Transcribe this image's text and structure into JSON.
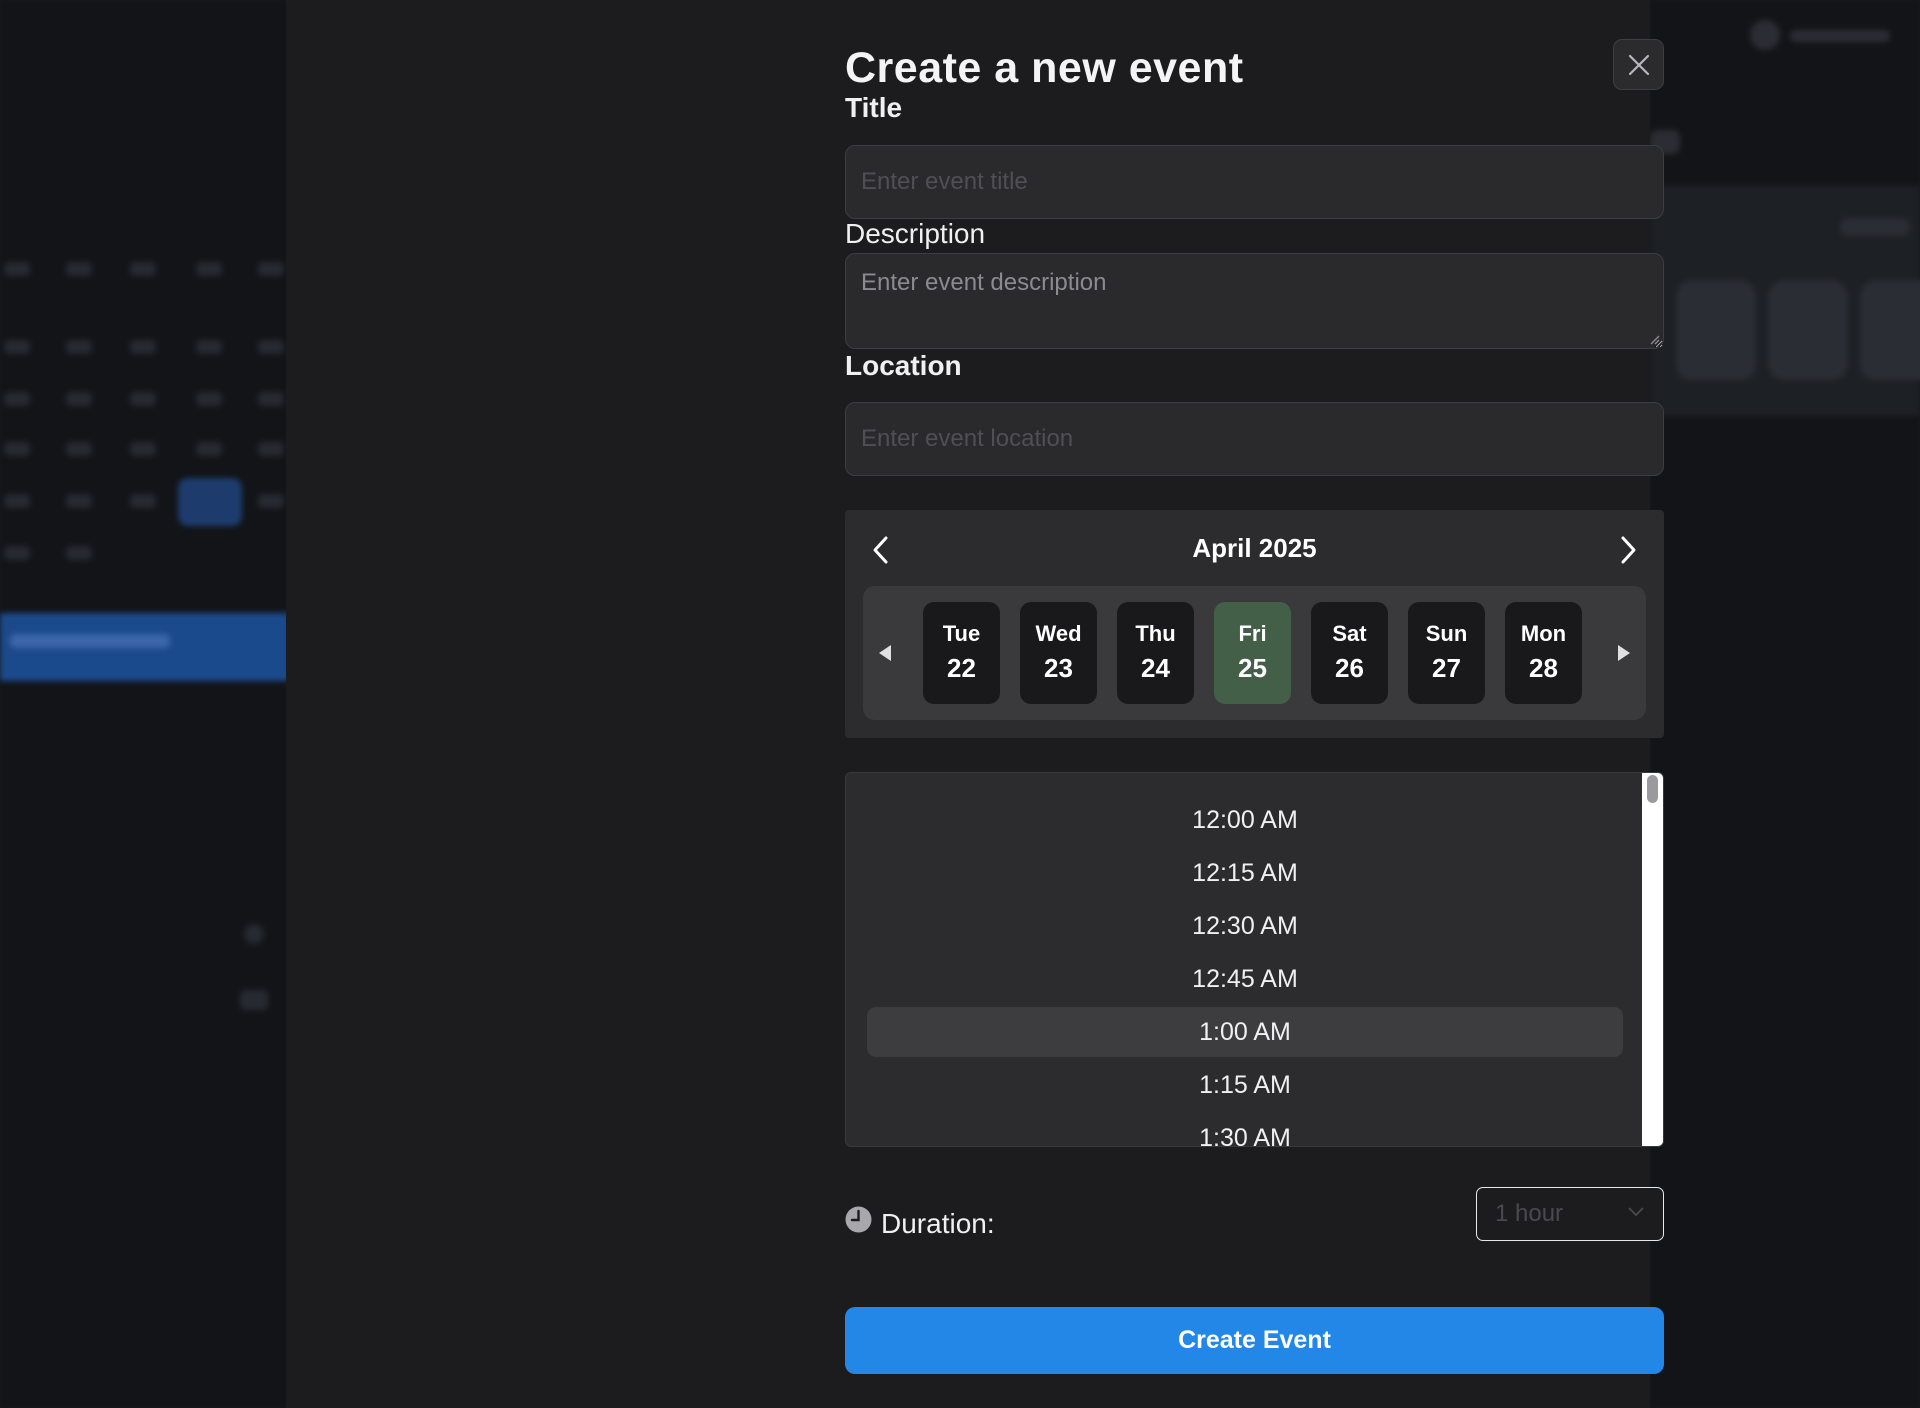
{
  "dialog": {
    "title": "Create a new event"
  },
  "form": {
    "title_label": "Title",
    "title_placeholder": "Enter event title",
    "description_label": "Description",
    "description_placeholder": "Enter event description",
    "location_label": "Location",
    "location_placeholder": "Enter event location"
  },
  "date_picker": {
    "month": "April 2025",
    "days": [
      {
        "name": "Tue",
        "num": "22",
        "selected": false
      },
      {
        "name": "Wed",
        "num": "23",
        "selected": false
      },
      {
        "name": "Thu",
        "num": "24",
        "selected": false
      },
      {
        "name": "Fri",
        "num": "25",
        "selected": true
      },
      {
        "name": "Sat",
        "num": "26",
        "selected": false
      },
      {
        "name": "Sun",
        "num": "27",
        "selected": false
      },
      {
        "name": "Mon",
        "num": "28",
        "selected": false
      }
    ],
    "selected_color": "#445f48"
  },
  "time_list": {
    "items": [
      "12:00 AM",
      "12:15 AM",
      "12:30 AM",
      "12:45 AM",
      "1:00 AM",
      "1:15 AM",
      "1:30 AM"
    ],
    "selected": "1:00 AM"
  },
  "duration": {
    "label": "Duration:",
    "value": "1 hour",
    "icon": "clock-icon"
  },
  "actions": {
    "create_label": "Create Event",
    "create_color": "#2387e8",
    "close_icon": "close-icon"
  }
}
